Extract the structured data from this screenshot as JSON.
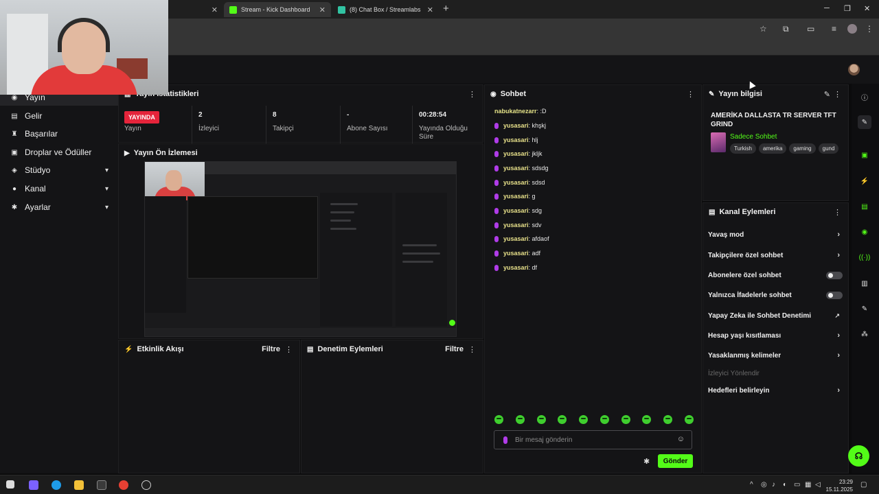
{
  "browser": {
    "tabs": [
      {
        "label": "",
        "favicon_color": "#53fc18"
      },
      {
        "label": "Stream - Kick Dashboard",
        "favicon_color": "#53fc18"
      },
      {
        "label": "(8) Chat Box / Streamlabs",
        "favicon_color": "#31c3a2"
      }
    ],
    "new_tab_icon": "plus-icon",
    "window_controls": [
      "minimize-icon",
      "restore-icon",
      "close-icon"
    ]
  },
  "sidebar": {
    "items": [
      {
        "label": "Yayın",
        "icon": "broadcast-icon",
        "active": true
      },
      {
        "label": "Gelir",
        "icon": "wallet-icon"
      },
      {
        "label": "Başarılar",
        "icon": "trophy-icon"
      },
      {
        "label": "Droplar ve Ödüller",
        "icon": "gift-icon"
      },
      {
        "label": "Stüdyo",
        "icon": "studio-icon",
        "expandable": true
      },
      {
        "label": "Kanal",
        "icon": "user-icon",
        "expandable": true
      },
      {
        "label": "Ayarlar",
        "icon": "gear-icon",
        "expandable": true
      }
    ]
  },
  "stats": {
    "title": "Yayın İstatistikleri",
    "live_label": "YAYINDA",
    "live_caption": "Yayın",
    "viewers_value": "2",
    "viewers_label": "İzleyici",
    "followers_value": "8",
    "followers_label": "Takipçi",
    "subs_value": "-",
    "subs_label": "Abone Sayısı",
    "uptime_value": "00:28:54",
    "uptime_label": "Yayında Olduğu Süre"
  },
  "preview": {
    "title": "Yayın Ön İzlemesi"
  },
  "activity": {
    "title": "Etkinlik Akışı",
    "filter": "Filtre"
  },
  "moderation": {
    "title": "Denetim Eylemleri",
    "filter": "Filtre"
  },
  "chat": {
    "title": "Sohbet",
    "messages": [
      {
        "user": "nabukatnezarr",
        "text": ":D",
        "badge": false
      },
      {
        "user": "yusasari",
        "text": "khşkj",
        "badge": true
      },
      {
        "user": "yusasari",
        "text": "hlj",
        "badge": true
      },
      {
        "user": "yusasari",
        "text": "jkljk",
        "badge": true
      },
      {
        "user": "yusasari",
        "text": "sdsdg",
        "badge": true
      },
      {
        "user": "yusasari",
        "text": "sdsd",
        "badge": true
      },
      {
        "user": "yusasari",
        "text": "g",
        "badge": true
      },
      {
        "user": "yusasari",
        "text": "sdg",
        "badge": true
      },
      {
        "user": "yusasari",
        "text": "sdv",
        "badge": true
      },
      {
        "user": "yusasari",
        "text": "afdaof",
        "badge": true
      },
      {
        "user": "yusasari",
        "text": "adf",
        "badge": true
      },
      {
        "user": "yusasari",
        "text": "df",
        "badge": true
      }
    ],
    "input_placeholder": "Bir mesaj gönderin",
    "send_label": "Gönder"
  },
  "stream_info": {
    "title": "Yayın bilgisi",
    "stream_title": "AMERİKA DALLASTA TR SERVER TFT GRIND",
    "category": "Sadece Sohbet",
    "tags": [
      "Turkish",
      "amerika",
      "gaming",
      "gund"
    ]
  },
  "channel_actions": {
    "title": "Kanal Eylemleri",
    "items": [
      {
        "label": "Yavaş mod",
        "control": "arrow"
      },
      {
        "label": "Takipçilere özel sohbet",
        "control": "arrow"
      },
      {
        "label": "Abonelere özel sohbet",
        "control": "toggle"
      },
      {
        "label": "Yalnızca İfadelerle sohbet",
        "control": "toggle"
      },
      {
        "label": "Yapay Zeka ile Sohbet Denetimi",
        "control": "external"
      },
      {
        "label": "Hesap yaşı kısıtlaması",
        "control": "arrow"
      },
      {
        "label": "Yasaklanmış kelimeler",
        "control": "arrow"
      },
      {
        "label": "İzleyici Yönlendir",
        "control": "none"
      },
      {
        "label": "Hedefleri belirleyin",
        "control": "arrow"
      }
    ]
  },
  "taskbar": {
    "time": "23:29",
    "date": "15.11.2025"
  },
  "colors": {
    "accent": "#53fc18",
    "live": "#e5243b",
    "badge": "#b03ce8",
    "username": "#e7e08a"
  }
}
